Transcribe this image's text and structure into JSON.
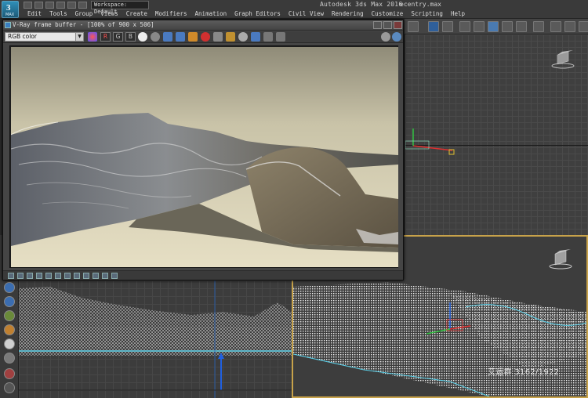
{
  "app": {
    "logo_text": "3",
    "logo_sub": "MAX",
    "title": "Autodesk 3ds Max 2016",
    "file_name": "ecentry.max",
    "workspace_label": "Workspace: Default"
  },
  "menu": [
    "Edit",
    "Tools",
    "Group",
    "Views",
    "Create",
    "Modifiers",
    "Animation",
    "Graph Editors",
    "Civil View",
    "Rendering",
    "Customize",
    "Scripting",
    "Help"
  ],
  "vfb": {
    "title": "V-Ray frame buffer - [100% of 900 x 506]",
    "channel": "RGB color",
    "channel_buttons": [
      "R",
      "G",
      "B"
    ]
  },
  "watermark": "艾运群 3162/1922",
  "colors": {
    "accent_active_viewport": "#c7a24a",
    "axis_x": "#e03030",
    "axis_y": "#30c040",
    "axis_z": "#2060e0"
  }
}
